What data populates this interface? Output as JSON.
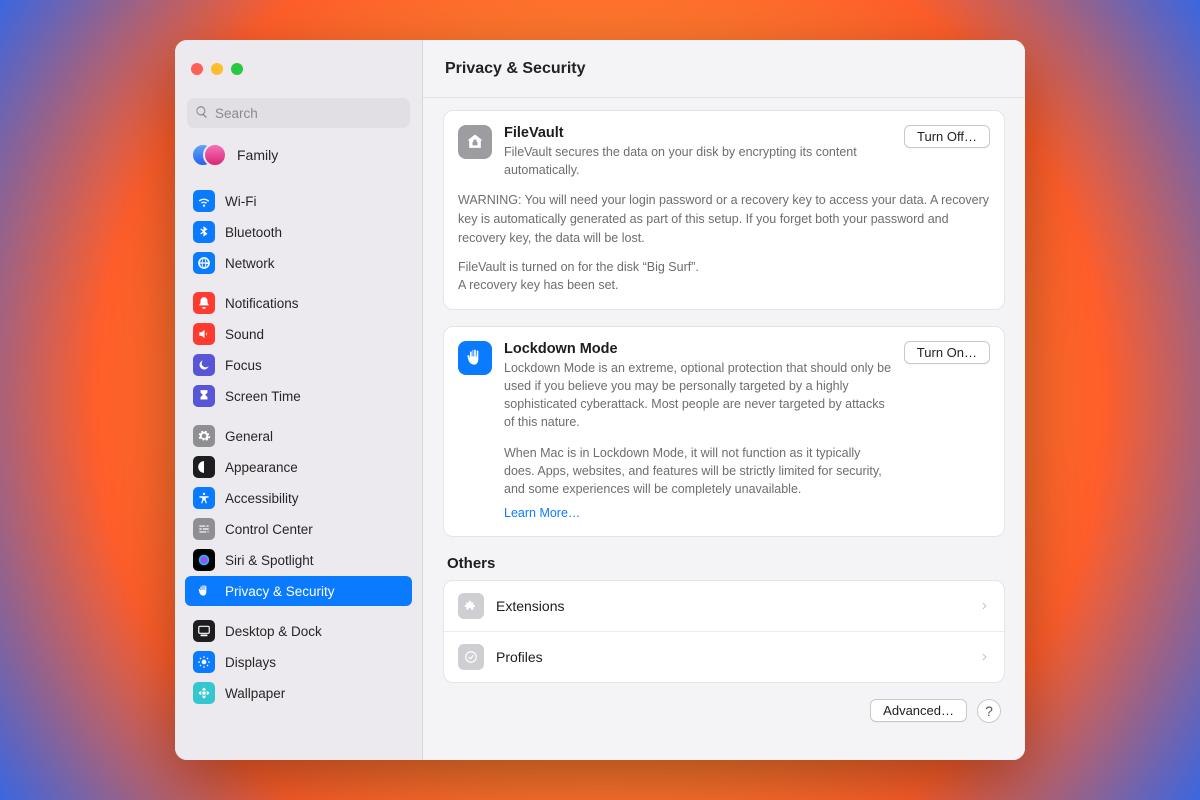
{
  "window": {
    "title": "Privacy & Security"
  },
  "search": {
    "placeholder": "Search"
  },
  "family": {
    "label": "Family"
  },
  "sidebar": {
    "groups": [
      [
        {
          "id": "wifi",
          "label": "Wi-Fi",
          "color": "#0a7bff",
          "icon": "wifi"
        },
        {
          "id": "bluetooth",
          "label": "Bluetooth",
          "color": "#0a7bff",
          "icon": "bluetooth"
        },
        {
          "id": "network",
          "label": "Network",
          "color": "#0a7bff",
          "icon": "globe"
        }
      ],
      [
        {
          "id": "notifications",
          "label": "Notifications",
          "color": "#ff3b30",
          "icon": "bell"
        },
        {
          "id": "sound",
          "label": "Sound",
          "color": "#ff3b30",
          "icon": "speaker"
        },
        {
          "id": "focus",
          "label": "Focus",
          "color": "#5856d6",
          "icon": "moon"
        },
        {
          "id": "screentime",
          "label": "Screen Time",
          "color": "#5856d6",
          "icon": "hourglass"
        }
      ],
      [
        {
          "id": "general",
          "label": "General",
          "color": "#8e8e93",
          "icon": "gear"
        },
        {
          "id": "appearance",
          "label": "Appearance",
          "color": "#1d1d1f",
          "icon": "appearance"
        },
        {
          "id": "accessibility",
          "label": "Accessibility",
          "color": "#0a7bff",
          "icon": "accessibility"
        },
        {
          "id": "controlcenter",
          "label": "Control Center",
          "color": "#8e8e93",
          "icon": "sliders"
        },
        {
          "id": "siri",
          "label": "Siri & Spotlight",
          "color": "#000",
          "icon": "siri"
        },
        {
          "id": "privacy",
          "label": "Privacy & Security",
          "color": "#0a7bff",
          "icon": "hand",
          "selected": true
        }
      ],
      [
        {
          "id": "desktopdock",
          "label": "Desktop & Dock",
          "color": "#1d1d1f",
          "icon": "dock"
        },
        {
          "id": "displays",
          "label": "Displays",
          "color": "#0a7bff",
          "icon": "sun"
        },
        {
          "id": "wallpaper",
          "label": "Wallpaper",
          "color": "#34c7cf",
          "icon": "flower"
        }
      ]
    ]
  },
  "filevault": {
    "title": "FileVault",
    "desc": "FileVault secures the data on your disk by encrypting its content automatically.",
    "button": "Turn Off…",
    "warning": "WARNING: You will need your login password or a recovery key to access your data. A recovery key is automatically generated as part of this setup. If you forget both your password and recovery key, the data will be lost.",
    "status1": "FileVault is turned on for the disk “Big Surf”.",
    "status2": "A recovery key has been set."
  },
  "lockdown": {
    "title": "Lockdown Mode",
    "desc": "Lockdown Mode is an extreme, optional protection that should only be used if you believe you may be personally targeted by a highly sophisticated cyberattack. Most people are never targeted by attacks of this nature.",
    "desc2": "When Mac is in Lockdown Mode, it will not function as it typically does. Apps, websites, and features will be strictly limited for security, and some experiences will be completely unavailable.",
    "learn": "Learn More…",
    "button": "Turn On…"
  },
  "others": {
    "heading": "Others",
    "rows": [
      {
        "id": "extensions",
        "label": "Extensions",
        "icon": "puzzle"
      },
      {
        "id": "profiles",
        "label": "Profiles",
        "icon": "badge"
      }
    ]
  },
  "footer": {
    "advanced": "Advanced…",
    "help": "?"
  }
}
